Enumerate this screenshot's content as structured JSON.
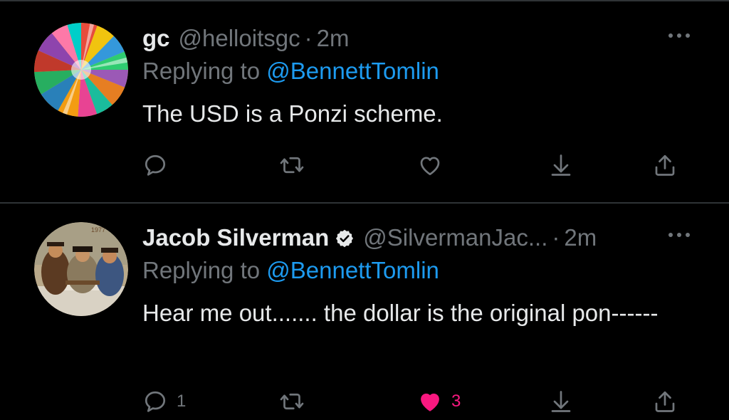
{
  "colors": {
    "background": "#000000",
    "text": "#e7e9ea",
    "muted": "#71767b",
    "link": "#1d9bf0",
    "like_active": "#f91880",
    "divider": "#2f3336"
  },
  "tweets": [
    {
      "name": "gc",
      "handle": "@helloitsgc",
      "separator": "·",
      "time": "2m",
      "verified": false,
      "replying_prefix": "Replying to",
      "replying_to": "@BennettTomlin",
      "text": "The USD is a Ponzi scheme.",
      "actions": {
        "reply": {
          "icon": "reply-icon",
          "count": ""
        },
        "retweet": {
          "icon": "retweet-icon",
          "count": ""
        },
        "like": {
          "icon": "heart-outline-icon",
          "count": "",
          "active": false
        },
        "bookmark": {
          "icon": "arrow-down-icon"
        },
        "share": {
          "icon": "share-icon"
        }
      }
    },
    {
      "name": "Jacob Silverman",
      "handle": "@SilvermanJac...",
      "separator": "·",
      "time": "2m",
      "verified": true,
      "replying_prefix": "Replying to",
      "replying_to": "@BennettTomlin",
      "text": "Hear me out....... the dollar is the original pon------",
      "actions": {
        "reply": {
          "icon": "reply-icon",
          "count": "1"
        },
        "retweet": {
          "icon": "retweet-icon",
          "count": ""
        },
        "like": {
          "icon": "heart-filled-icon",
          "count": "3",
          "active": true
        },
        "bookmark": {
          "icon": "arrow-down-icon"
        },
        "share": {
          "icon": "share-icon"
        }
      }
    }
  ]
}
